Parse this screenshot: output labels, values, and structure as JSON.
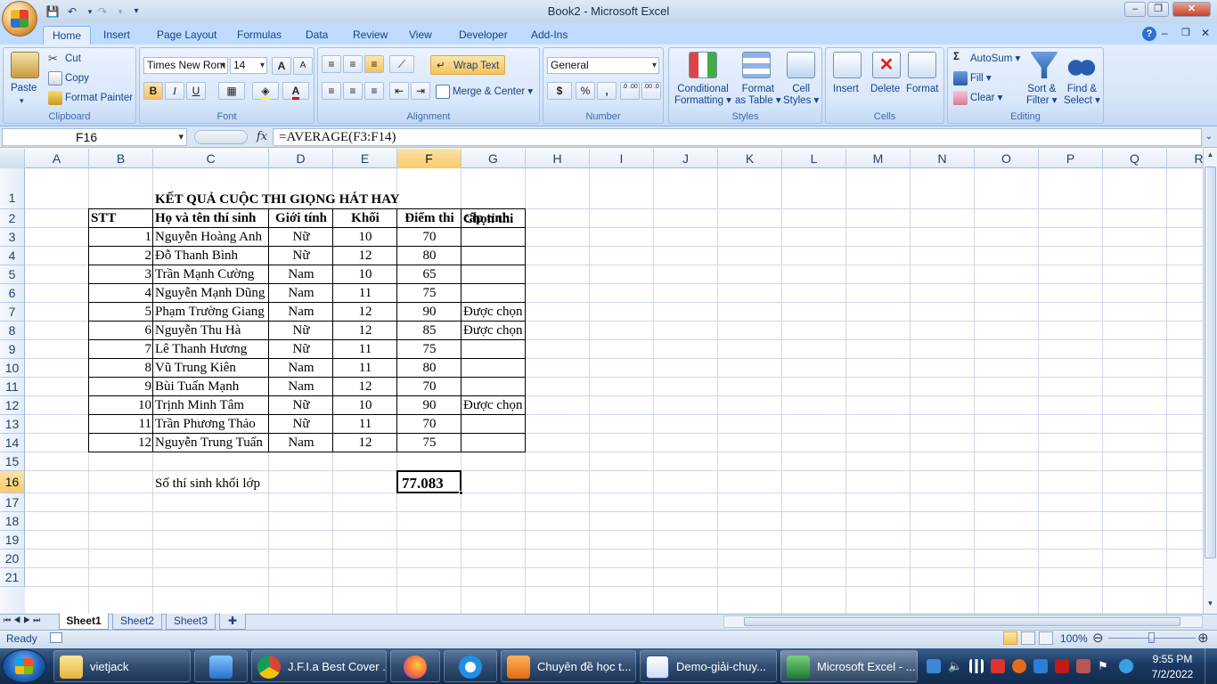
{
  "window": {
    "title": "Book2 - Microsoft Excel",
    "qat_icons": [
      "save-icon",
      "undo-icon",
      "redo-icon",
      "customize-icon"
    ],
    "controls": {
      "minimize": "–",
      "restore": "❐",
      "close": "✕"
    },
    "doc_controls": {
      "help": "?",
      "minimize": "–",
      "restore": "❐",
      "close": "✕"
    }
  },
  "tabs": [
    "Home",
    "Insert",
    "Page Layout",
    "Formulas",
    "Data",
    "Review",
    "View",
    "Developer",
    "Add-Ins"
  ],
  "ribbon": {
    "clipboard": {
      "label": "Clipboard",
      "paste": "Paste",
      "cut": "Cut",
      "copy": "Copy",
      "format_painter": "Format Painter"
    },
    "font": {
      "label": "Font",
      "family": "Times New Rom",
      "size": "14",
      "grow": "A",
      "shrink": "A",
      "bold": "B",
      "italic": "I",
      "underline": "U"
    },
    "alignment": {
      "label": "Alignment",
      "wrap_text": "Wrap Text",
      "merge_center": "Merge & Center"
    },
    "number": {
      "label": "Number",
      "format": "General",
      "currency": "$",
      "percent": "%",
      "comma": ",",
      "inc_dec": ".0 .00",
      "dec_dec": ".00 .0"
    },
    "styles": {
      "label": "Styles",
      "conditional": [
        "Conditional",
        "Formatting ▾"
      ],
      "format_table": [
        "Format",
        "as Table ▾"
      ],
      "cell_styles": [
        "Cell",
        "Styles ▾"
      ]
    },
    "cells": {
      "label": "Cells",
      "insert": "Insert",
      "delete": "Delete",
      "format": "Format"
    },
    "editing": {
      "label": "Editing",
      "autosum": "AutoSum",
      "fill": "Fill",
      "clear": "Clear",
      "sort_filter": [
        "Sort &",
        "Filter ▾"
      ],
      "find_select": [
        "Find &",
        "Select ▾"
      ]
    }
  },
  "formula_bar": {
    "name_box": "F16",
    "fx": "fx",
    "formula": "=AVERAGE(F3:F14)"
  },
  "columns": [
    "A",
    "B",
    "C",
    "D",
    "E",
    "F",
    "G",
    "H",
    "I",
    "J",
    "K",
    "L",
    "M",
    "N",
    "O",
    "P",
    "Q",
    "R"
  ],
  "rows": [
    "1",
    "2",
    "3",
    "4",
    "5",
    "6",
    "7",
    "8",
    "9",
    "10",
    "11",
    "12",
    "13",
    "14",
    "15",
    "16",
    "17",
    "18",
    "19",
    "20",
    "21"
  ],
  "sheet": {
    "title": "KẾT QUẢ CUỘC THI GIỌNG HÁT HAY",
    "headers": {
      "stt": "STT",
      "name": "Họ và tên thí sinh",
      "gender": "Giới tính",
      "grade": "Khối",
      "score": "Điểm thi",
      "select_1": "Chọn thi",
      "select_2": "cấp tỉnh"
    },
    "records": [
      {
        "stt": "1",
        "name": "Nguyễn Hoàng Anh",
        "gender": "Nữ",
        "grade": "10",
        "score": "70",
        "chosen": ""
      },
      {
        "stt": "2",
        "name": "Đỗ Thanh Bình",
        "gender": "Nữ",
        "grade": "12",
        "score": "80",
        "chosen": ""
      },
      {
        "stt": "3",
        "name": "Trần Mạnh Cường",
        "gender": "Nam",
        "grade": "10",
        "score": "65",
        "chosen": ""
      },
      {
        "stt": "4",
        "name": "Nguyễn Mạnh Dũng",
        "gender": "Nam",
        "grade": "11",
        "score": "75",
        "chosen": ""
      },
      {
        "stt": "5",
        "name": "Phạm Trường Giang",
        "gender": "Nam",
        "grade": "12",
        "score": "90",
        "chosen": "Được chọn"
      },
      {
        "stt": "6",
        "name": "Nguyễn Thu Hà",
        "gender": "Nữ",
        "grade": "12",
        "score": "85",
        "chosen": "Được chọn"
      },
      {
        "stt": "7",
        "name": "Lê Thanh Hương",
        "gender": "Nữ",
        "grade": "11",
        "score": "75",
        "chosen": ""
      },
      {
        "stt": "8",
        "name": "Vũ Trung Kiên",
        "gender": "Nam",
        "grade": "11",
        "score": "80",
        "chosen": ""
      },
      {
        "stt": "9",
        "name": "Bùi Tuấn Mạnh",
        "gender": "Nam",
        "grade": "12",
        "score": "70",
        "chosen": ""
      },
      {
        "stt": "10",
        "name": "Trịnh Minh Tâm",
        "gender": "Nữ",
        "grade": "10",
        "score": "90",
        "chosen": "Được chọn"
      },
      {
        "stt": "11",
        "name": "Trần Phương Thảo",
        "gender": "Nữ",
        "grade": "11",
        "score": "70",
        "chosen": ""
      },
      {
        "stt": "12",
        "name": "Nguyễn Trung Tuấn",
        "gender": "Nam",
        "grade": "12",
        "score": "75",
        "chosen": ""
      }
    ],
    "summary_label": "Số thí sinh khối lớp",
    "summary_value": "77.083"
  },
  "sheet_tabs": [
    "Sheet1",
    "Sheet2",
    "Sheet3"
  ],
  "status": {
    "ready": "Ready",
    "zoom": "100%",
    "zoom_minus": "⊖",
    "zoom_plus": "⊕"
  },
  "taskbar": {
    "items": [
      "vietjack",
      "",
      "J.F.I.a Best Cover ...",
      "",
      "",
      "Chuyên đề học t...",
      "Demo-giải-chuy...",
      "Microsoft Excel - ..."
    ],
    "time": "9:55 PM",
    "date": "7/2/2022"
  },
  "colors": {
    "accent": "#15428b",
    "selection": "#f8c96a",
    "ribbon": "#d5e4f7"
  }
}
